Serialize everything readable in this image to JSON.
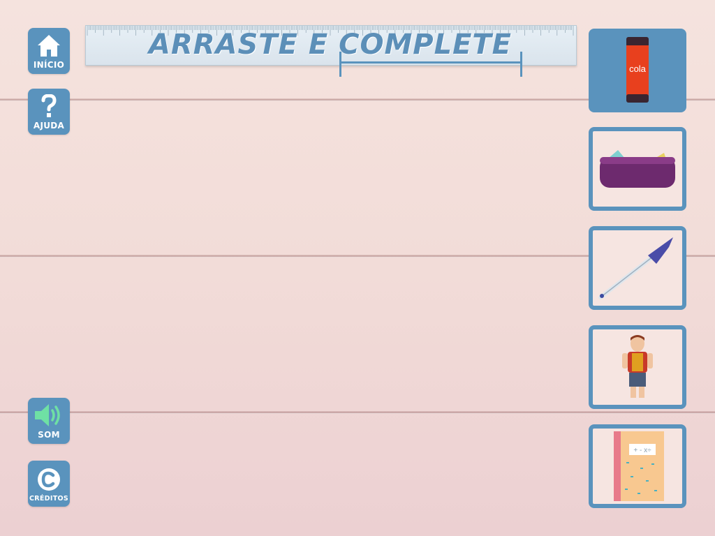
{
  "title": "ARRASTE E COMPLETE",
  "sidebar": {
    "home_label": "INÍCIO",
    "help_label": "AJUDA",
    "sound_label": "SOM",
    "credits_label": "CRÉDITOS"
  },
  "cards": [
    {
      "name": "glue-stick",
      "label": "cola",
      "selected": true
    },
    {
      "name": "pencil-case",
      "selected": false
    },
    {
      "name": "ballpoint-pen",
      "selected": false
    },
    {
      "name": "toy-figure",
      "selected": false
    },
    {
      "name": "notebook",
      "cover_text": "+ - x÷",
      "selected": false
    }
  ],
  "colors": {
    "accent": "#5a93bd",
    "sound_icon": "#6fe0a4"
  }
}
